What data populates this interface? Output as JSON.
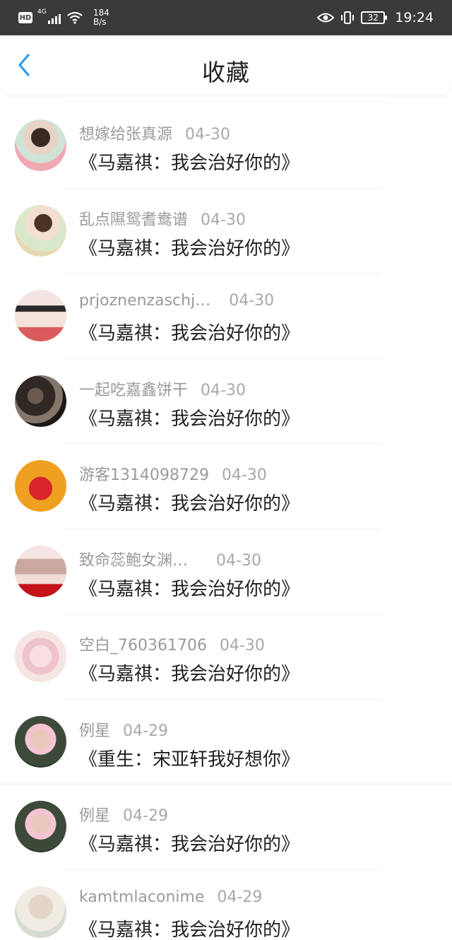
{
  "status_bar": {
    "hd": "HD",
    "network": "4G",
    "speed_value": "184",
    "speed_unit": "B/s",
    "battery": "32",
    "time": "19:24"
  },
  "header": {
    "title": "收藏"
  },
  "colors": {
    "accent": "#2a9cf0",
    "status_bar_bg": "#3a3a3a"
  },
  "items": [
    {
      "user": "想嫁给张真源",
      "date": "04-30",
      "title": "《马嘉祺：我会治好你的》",
      "avatar": "avatar-icon"
    },
    {
      "user": "乱点隰鸳耆鸯谱",
      "date": "04-30",
      "title": "《马嘉祺：我会治好你的》",
      "avatar": "avatar-icon"
    },
    {
      "user": "prjoznenzaschj…",
      "date": "04-30",
      "title": "《马嘉祺：我会治好你的》",
      "avatar": "avatar-icon"
    },
    {
      "user": "一起吃嘉鑫饼干",
      "date": "04-30",
      "title": "《马嘉祺：我会治好你的》",
      "avatar": "avatar-icon"
    },
    {
      "user": "游客1314098729",
      "date": "04-30",
      "title": "《马嘉祺：我会治好你的》",
      "avatar": "avatar-icon"
    },
    {
      "user": "致命蕊鲍女渊…",
      "date": "04-30",
      "title": "《马嘉祺：我会治好你的》",
      "avatar": "avatar-icon"
    },
    {
      "user": "空白_760361706",
      "date": "04-30",
      "title": "《马嘉祺：我会治好你的》",
      "avatar": "avatar-icon"
    },
    {
      "user": "例星",
      "date": "04-29",
      "title": "《重生：宋亚轩我好想你》",
      "avatar": "avatar-icon"
    },
    {
      "user": "例星",
      "date": "04-29",
      "title": "《马嘉祺：我会治好你的》",
      "avatar": "avatar-icon"
    },
    {
      "user": "kamtmlaconime",
      "date": "04-29",
      "title": "《马嘉祺：我会治好你的》",
      "avatar": "avatar-icon"
    }
  ]
}
